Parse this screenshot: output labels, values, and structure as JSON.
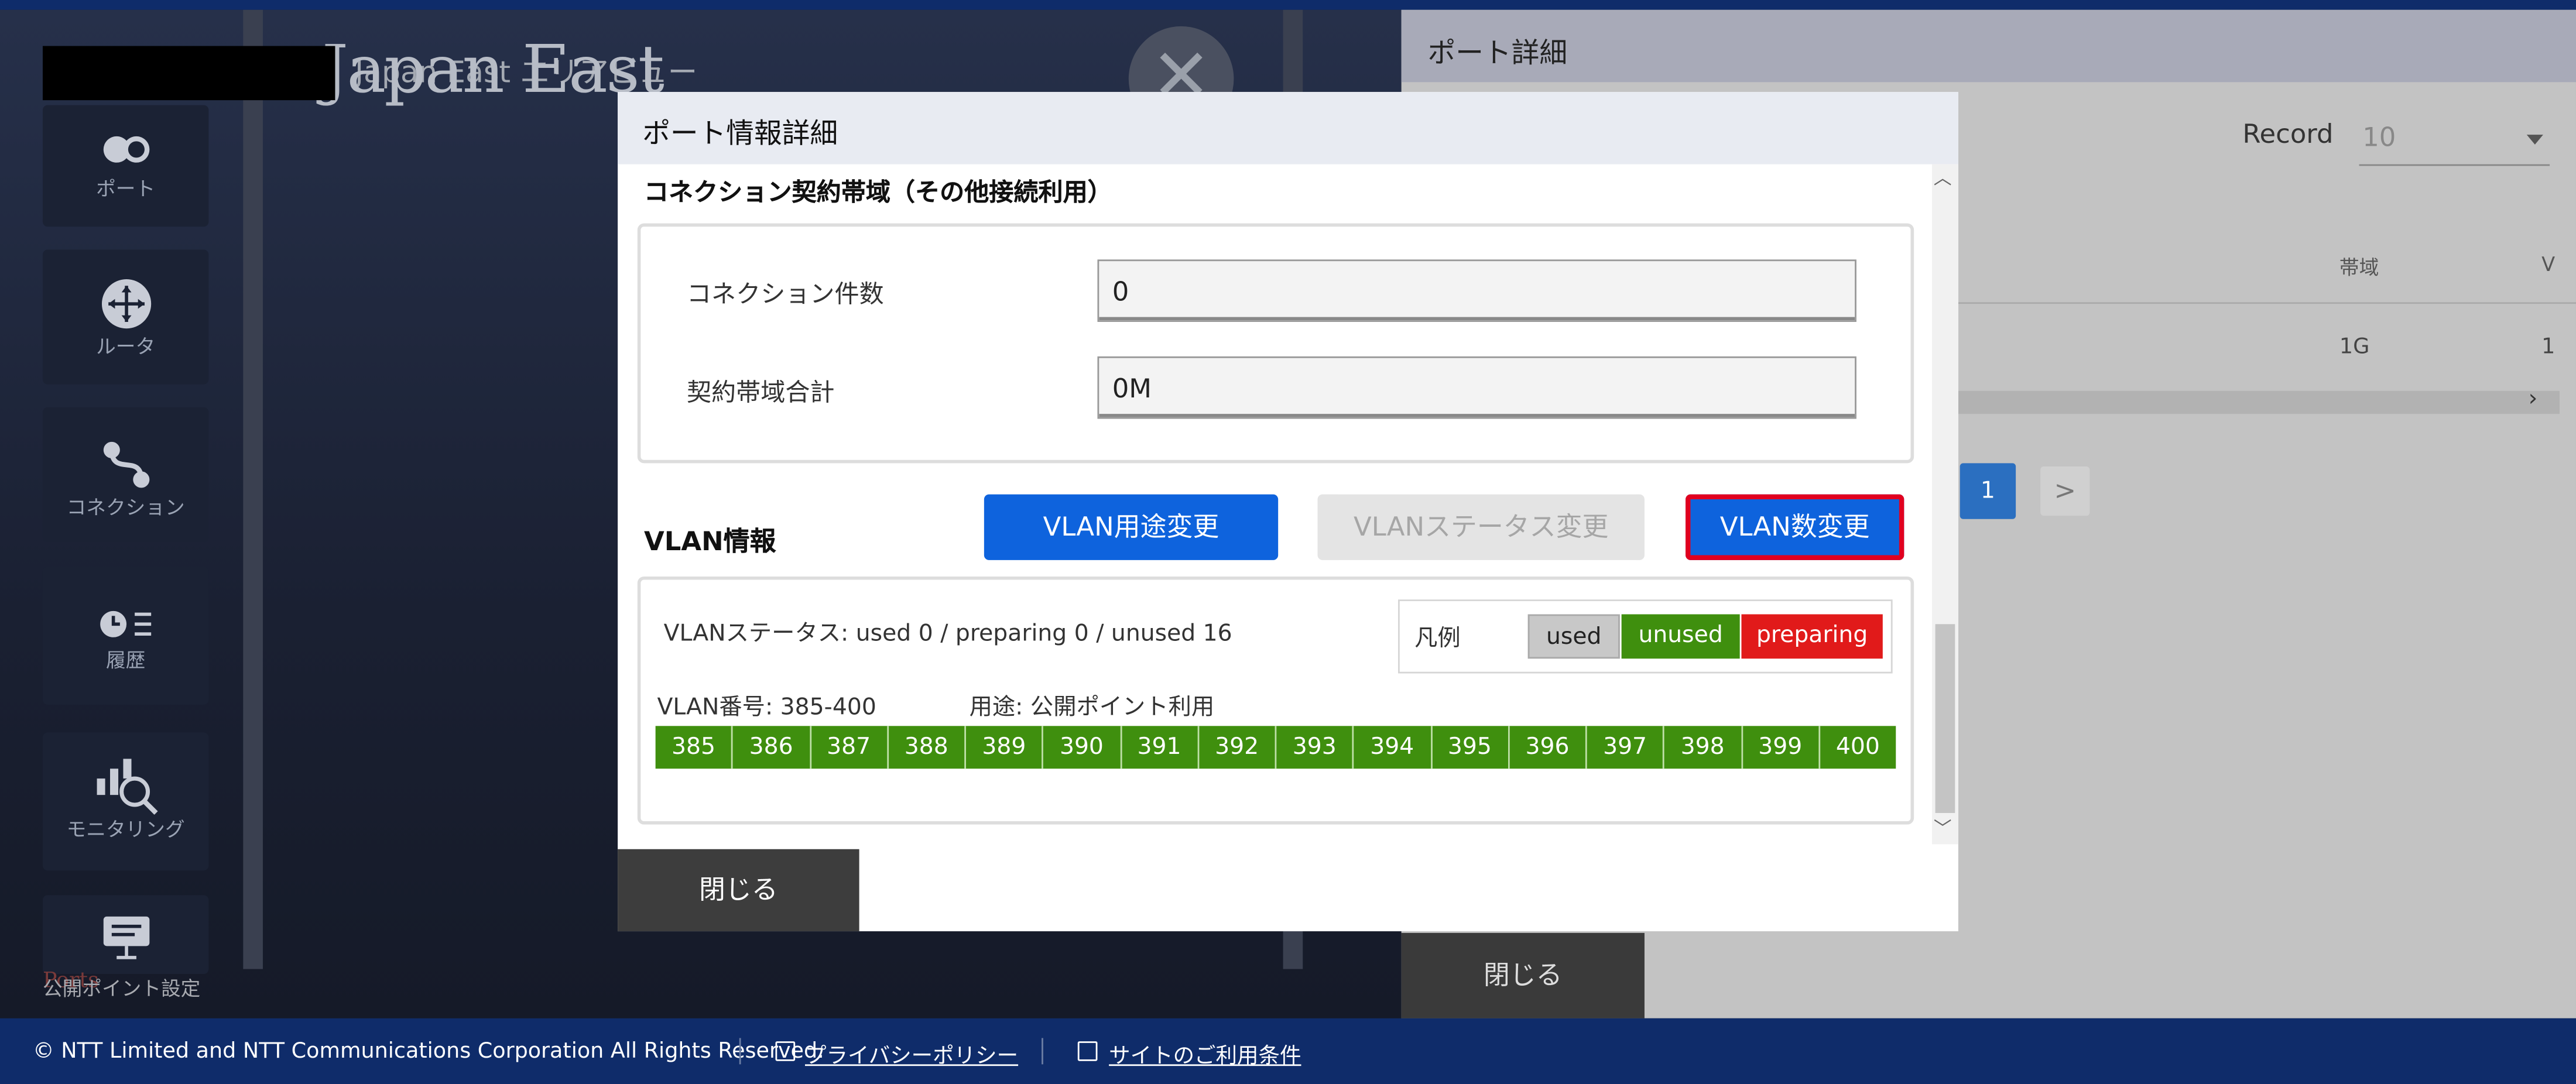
{
  "background": {
    "title": "Japan East",
    "title_small": "Japan East エリアビュー",
    "nav": [
      {
        "label": "ポート",
        "icon": "port-icon"
      },
      {
        "label": "ルータ",
        "icon": "router-icon"
      },
      {
        "label": "コネクション",
        "icon": "connection-icon"
      },
      {
        "label": "履歴",
        "icon": "history-icon"
      },
      {
        "label": "モニタリング",
        "icon": "monitoring-icon"
      },
      {
        "label": "公開ポイント設定",
        "icon": "display-icon"
      }
    ],
    "faint_caption": "Ports"
  },
  "right_panel": {
    "title": "ポート詳細",
    "record_label": "Record",
    "record_value": "10",
    "col_band": "帯域",
    "col_v": "V",
    "cell_band": "1G",
    "cell_v": "1",
    "page_current": "1",
    "next_label": ">",
    "close_label": "閉じる"
  },
  "modal": {
    "title": "ポート情報詳細",
    "section_title": "コネクション契約帯域（その他接続利用）",
    "connection_count_label": "コネクション件数",
    "connection_count_value": "0",
    "bandwidth_total_label": "契約帯域合計",
    "bandwidth_total_value": "0M",
    "vlan_title": "VLAN情報",
    "buttons": {
      "purpose_change": "VLAN用途変更",
      "status_change": "VLANステータス変更",
      "count_change": "VLAN数変更"
    },
    "vlan_status_text": "VLANステータス: used 0 / preparing 0 / unused 16",
    "legend": {
      "label": "凡例",
      "used": "used",
      "unused": "unused",
      "preparing": "preparing"
    },
    "vlan_number_text": "VLAN番号: 385-400",
    "vlan_use_text": "用途: 公開ポイント利用",
    "vlans": [
      "385",
      "386",
      "387",
      "388",
      "389",
      "390",
      "391",
      "392",
      "393",
      "394",
      "395",
      "396",
      "397",
      "398",
      "399",
      "400"
    ],
    "close_label": "閉じる"
  },
  "footer": {
    "copyright": "© NTT Limited and NTT Communications Corporation All Rights Reserved.",
    "privacy": "プライバシーポリシー",
    "terms": "サイトのご利用条件"
  },
  "colors": {
    "primary_button": "#0e63dd",
    "unused_green": "#3f8f0e",
    "preparing_red": "#e11a1a",
    "highlight_outline": "#e1001f",
    "footer_navy": "#0f2c6a"
  }
}
